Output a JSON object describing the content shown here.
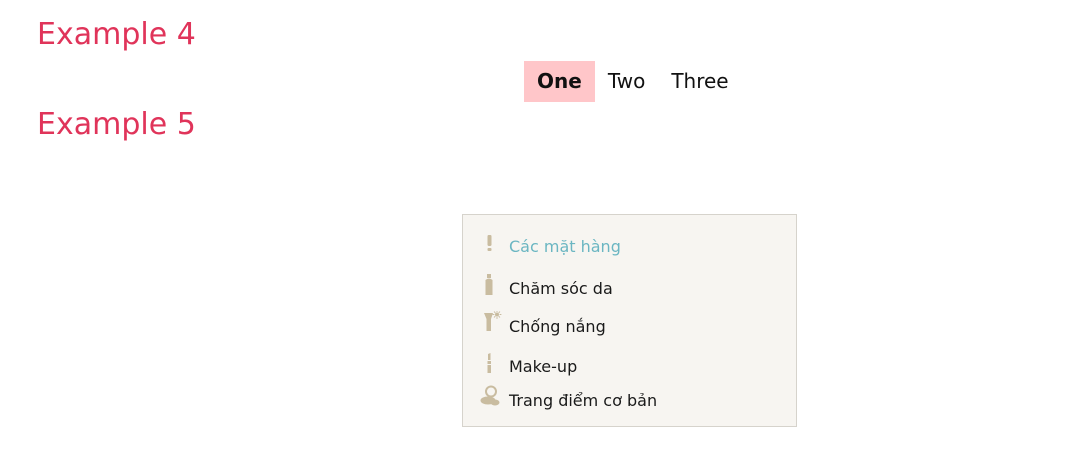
{
  "headings": {
    "example4": "Example 4",
    "example5": "Example 5"
  },
  "tabs": [
    {
      "label": "One",
      "active": true
    },
    {
      "label": "Two",
      "active": false
    },
    {
      "label": "Three",
      "active": false
    }
  ],
  "menu": {
    "items": [
      {
        "label": "Các mặt hàng",
        "icon": "exclamation-icon",
        "highlight": true
      },
      {
        "label": "Chăm sóc da",
        "icon": "skincare-bottle-icon",
        "highlight": false
      },
      {
        "label": "Chống nắng",
        "icon": "sunscreen-icon",
        "highlight": false
      },
      {
        "label": "Make-up",
        "icon": "lipstick-icon",
        "highlight": false
      },
      {
        "label": "Trang điểm cơ bản",
        "icon": "powder-compact-icon",
        "highlight": false
      }
    ]
  },
  "colors": {
    "heading": "#e0345a",
    "active_tab_bg": "#ffc6c9",
    "menu_bg": "#f7f5f1",
    "menu_highlight": "#6bb6c2",
    "icon_beige": "#c9bca0"
  }
}
